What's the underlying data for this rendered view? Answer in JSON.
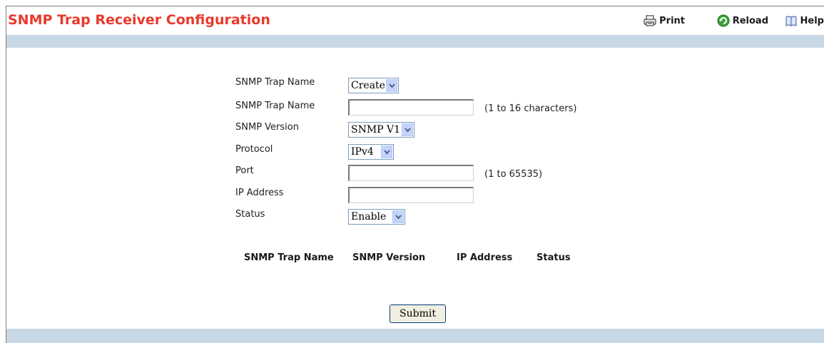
{
  "page": {
    "title": "SNMP Trap Receiver Configuration"
  },
  "toolbar": {
    "print_label": "Print",
    "reload_label": "Reload",
    "help_label": "Help"
  },
  "form": {
    "trap_name_select": {
      "label": "SNMP Trap Name",
      "value": "Create"
    },
    "trap_name_input": {
      "label": "SNMP Trap Name",
      "value": "",
      "hint": "(1 to 16 characters)"
    },
    "snmp_version": {
      "label": "SNMP Version",
      "value": "SNMP V1"
    },
    "protocol": {
      "label": "Protocol",
      "value": "IPv4"
    },
    "port": {
      "label": "Port",
      "value": "",
      "hint": "(1 to 65535)"
    },
    "ip_address": {
      "label": "IP Address",
      "value": ""
    },
    "status": {
      "label": "Status",
      "value": "Enable"
    }
  },
  "table": {
    "columns": [
      "SNMP Trap Name",
      "SNMP Version",
      "IP Address",
      "Status"
    ],
    "rows": []
  },
  "actions": {
    "submit_label": "Submit"
  },
  "colors": {
    "title": "#e8392b",
    "band": "#c8d8e4"
  }
}
